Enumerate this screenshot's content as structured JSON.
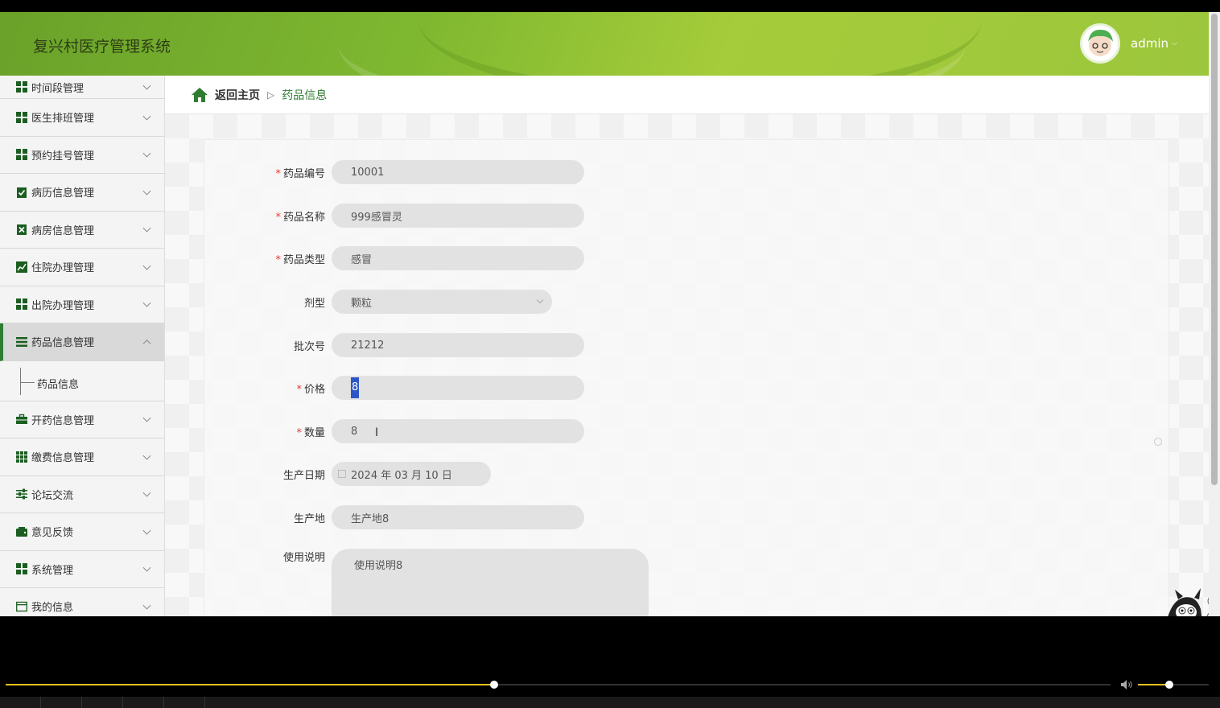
{
  "app": {
    "title": "复兴村医疗管理系统",
    "user": "admin"
  },
  "sidebar": {
    "items": [
      {
        "label": "时间段管理",
        "icon": "grid-icon"
      },
      {
        "label": "医生排班管理",
        "icon": "grid-icon"
      },
      {
        "label": "预约挂号管理",
        "icon": "grid-icon"
      },
      {
        "label": "病历信息管理",
        "icon": "clipboard-check-icon"
      },
      {
        "label": "病房信息管理",
        "icon": "clipboard-x-icon"
      },
      {
        "label": "住院办理管理",
        "icon": "chart-line-icon"
      },
      {
        "label": "出院办理管理",
        "icon": "grid-icon"
      },
      {
        "label": "药品信息管理",
        "icon": "list-icon"
      },
      {
        "label": "开药信息管理",
        "icon": "briefcase-icon"
      },
      {
        "label": "缴费信息管理",
        "icon": "grid-icon"
      },
      {
        "label": "论坛交流",
        "icon": "sliders-icon"
      },
      {
        "label": "意见反馈",
        "icon": "wallet-icon"
      },
      {
        "label": "系统管理",
        "icon": "grid-icon"
      },
      {
        "label": "我的信息",
        "icon": "card-icon"
      }
    ],
    "active_sub": "药品信息"
  },
  "breadcrumb": {
    "home": "返回主页",
    "separator": "▷",
    "current": "药品信息"
  },
  "form": {
    "code": {
      "label": "药品编号",
      "value": "10001"
    },
    "name": {
      "label": "药品名称",
      "value": "999感冒灵"
    },
    "type": {
      "label": "药品类型",
      "value": "感冒"
    },
    "dosage": {
      "label": "剂型",
      "value": "颗粒"
    },
    "batch": {
      "label": "批次号",
      "value": "21212"
    },
    "price": {
      "label": "价格",
      "value": "8"
    },
    "qty": {
      "label": "数量",
      "value": "8"
    },
    "date": {
      "label": "生产日期",
      "value": "2024 年 03 月 10 日"
    },
    "origin": {
      "label": "生产地",
      "value": "生产地8"
    },
    "usage": {
      "label": "使用说明",
      "value": "使用说明8"
    }
  },
  "player": {
    "progress": 0.442,
    "volume": 0.44
  },
  "colors": {
    "header_green": "#8bbf34",
    "accent_green": "#2e7d32",
    "required_red": "#e53935",
    "progress_yellow": "#e6c020"
  }
}
